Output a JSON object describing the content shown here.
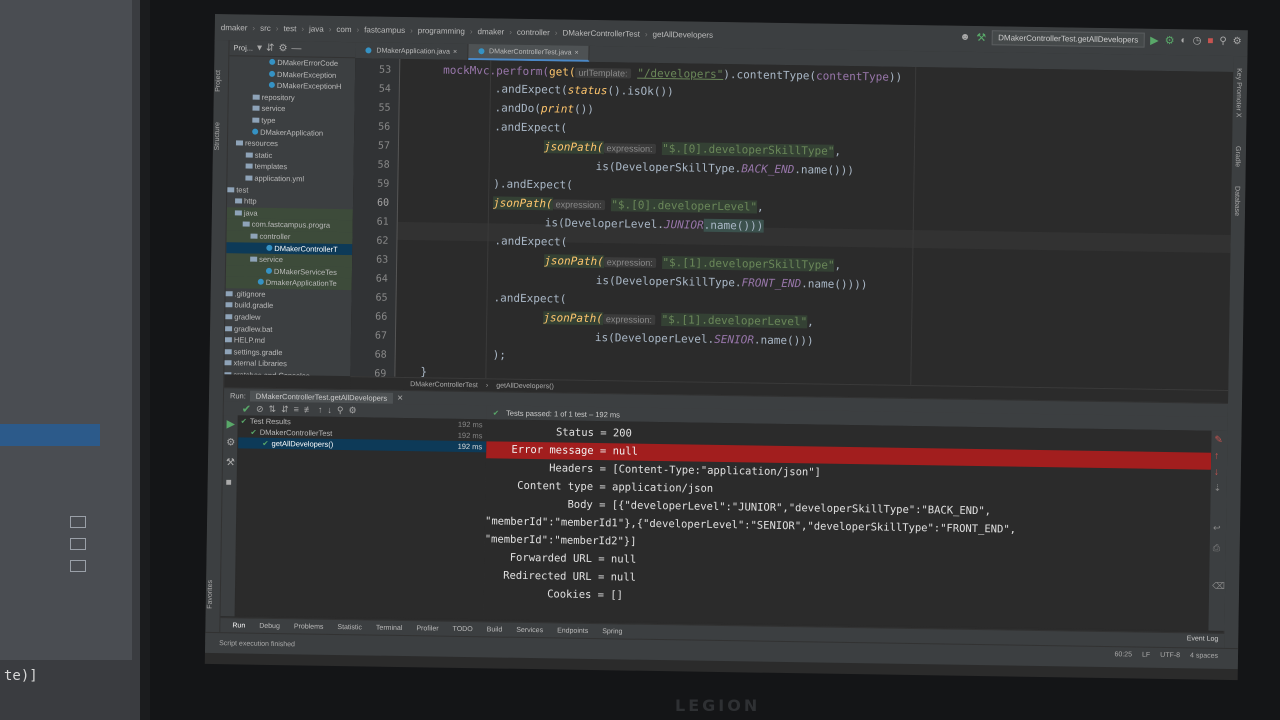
{
  "left_monitor": {
    "fragment_text": "te)]"
  },
  "monitor_brand": "LEGION",
  "nav": {
    "crumbs": [
      "dmaker",
      "src",
      "test",
      "java",
      "com",
      "fastcampus",
      "programming",
      "dmaker",
      "controller",
      "DMakerControllerTest",
      "getAllDevelopers"
    ],
    "run_config": "DMakerControllerTest.getAllDevelopers"
  },
  "project": {
    "header": "Proj...",
    "items": [
      {
        "label": "DMakerErrorCode",
        "indent": 40,
        "kind": "class"
      },
      {
        "label": "DMakerException",
        "indent": 40,
        "kind": "class"
      },
      {
        "label": "DMakerExceptionH",
        "indent": 40,
        "kind": "class"
      },
      {
        "label": "repository",
        "indent": 24,
        "kind": "folder"
      },
      {
        "label": "service",
        "indent": 24,
        "kind": "folder"
      },
      {
        "label": "type",
        "indent": 24,
        "kind": "folder"
      },
      {
        "label": "DMakerApplication",
        "indent": 24,
        "kind": "class"
      },
      {
        "label": "resources",
        "indent": 8,
        "kind": "folder"
      },
      {
        "label": "static",
        "indent": 18,
        "kind": "folder"
      },
      {
        "label": "templates",
        "indent": 18,
        "kind": "folder"
      },
      {
        "label": "application.yml",
        "indent": 18,
        "kind": "file"
      },
      {
        "label": "test",
        "indent": 0,
        "kind": "folder"
      },
      {
        "label": "http",
        "indent": 8,
        "kind": "folder"
      },
      {
        "label": "java",
        "indent": 8,
        "kind": "folder",
        "hl": true
      },
      {
        "label": "com.fastcampus.progra",
        "indent": 16,
        "kind": "folder",
        "hl": true
      },
      {
        "label": "controller",
        "indent": 24,
        "kind": "folder",
        "hl": true
      },
      {
        "label": "DMakerControllerT",
        "indent": 40,
        "kind": "class",
        "sel": true
      },
      {
        "label": "service",
        "indent": 24,
        "kind": "folder",
        "hl": true
      },
      {
        "label": "DMakerServiceTes",
        "indent": 40,
        "kind": "class",
        "hl": true
      },
      {
        "label": "DmakerApplicationTe",
        "indent": 32,
        "kind": "class",
        "hl": true
      },
      {
        "label": ".gitignore",
        "indent": 0,
        "kind": "file"
      },
      {
        "label": "build.gradle",
        "indent": 0,
        "kind": "file"
      },
      {
        "label": "gradlew",
        "indent": 0,
        "kind": "file"
      },
      {
        "label": "gradlew.bat",
        "indent": 0,
        "kind": "file"
      },
      {
        "label": "HELP.md",
        "indent": 0,
        "kind": "file"
      },
      {
        "label": "settings.gradle",
        "indent": 0,
        "kind": "file"
      },
      {
        "label": "xternal Libraries",
        "indent": 0,
        "kind": "lib"
      },
      {
        "label": "cratches and Consoles",
        "indent": 0,
        "kind": "lib"
      }
    ]
  },
  "side_labels": {
    "left": [
      "Project",
      "Structure",
      "Favorites"
    ],
    "right": [
      "Key Promoter X",
      "Gradle",
      "Database"
    ]
  },
  "editor": {
    "tabs": [
      {
        "label": "DMakerApplication.java",
        "active": false
      },
      {
        "label": "DMakerControllerTest.java",
        "active": true
      }
    ],
    "line_numbers": [
      "53",
      "54",
      "55",
      "56",
      "57",
      "58",
      "59",
      "60",
      "61",
      "62",
      "63",
      "64",
      "65",
      "66",
      "67",
      "68",
      "69"
    ],
    "current_line": "60",
    "lines": {
      "l53": {
        "a": "mockMvc.perform(",
        "b": "get(",
        "hint": "urlTemplate:",
        "str": "\"/developers\"",
        "c": ").contentType(",
        "d": "contentType",
        "e": "))"
      },
      "l54": {
        "a": ".andExpect(",
        "b": "status",
        "c": "().isOk())"
      },
      "l55": {
        "a": ".andDo(",
        "b": "print",
        "c": "())"
      },
      "l56": {
        "a": ".andExpect("
      },
      "l57": {
        "a": "jsonPath(",
        "hint": "expression:",
        "str": "\"$.[0].developerSkillType\"",
        "c": ","
      },
      "l58": {
        "a": "is(DeveloperSkillType.",
        "b": "BACK_END",
        "c": ".name()))"
      },
      "l59": {
        "a": ").andExpect("
      },
      "l60": {
        "a": "jsonPath(",
        "hint": "expression:",
        "str": "\"$.[0].developerLevel\"",
        "c": ","
      },
      "l61": {
        "a": "is(DeveloperLevel.",
        "b": "JUNIOR",
        "c": ".name()))"
      },
      "l62": {
        "a": ".andExpect("
      },
      "l63": {
        "a": "jsonPath(",
        "hint": "expression:",
        "str": "\"$.[1].developerSkillType\"",
        "c": ","
      },
      "l64": {
        "a": "is(DeveloperSkillType.",
        "b": "FRONT_END",
        "c": ".name())))"
      },
      "l65": {
        "a": ".andExpect("
      },
      "l66": {
        "a": "jsonPath(",
        "hint": "expression:",
        "str": "\"$.[1].developerLevel\"",
        "c": ","
      },
      "l67": {
        "a": "is(DeveloperLevel.",
        "b": "SENIOR",
        "c": ".name()))"
      },
      "l68": {
        "a": ");"
      },
      "l69": {
        "a": "}"
      }
    },
    "breadcrumbs": [
      "DMakerControllerTest",
      "getAllDevelopers()"
    ]
  },
  "run": {
    "label": "Run:",
    "tab": "DMakerControllerTest.getAllDevelopers",
    "status": "Tests passed: 1 of 1 test – 192 ms",
    "tree": [
      {
        "label": "Test Results",
        "time": "192 ms",
        "indent": 2,
        "sel": false
      },
      {
        "label": "DMakerControllerTest",
        "time": "192 ms",
        "indent": 12,
        "sel": false
      },
      {
        "label": "getAllDevelopers()",
        "time": "192 ms",
        "indent": 24,
        "sel": true
      }
    ],
    "console": [
      {
        "text": "           Status = 200",
        "error": false
      },
      {
        "text": "    Error message = null",
        "error": true
      },
      {
        "text": "          Headers = [Content-Type:\"application/json\"]",
        "error": false
      },
      {
        "text": "     Content type = application/json",
        "error": false
      },
      {
        "text": "             Body = [{\"developerLevel\":\"JUNIOR\",\"developerSkillType\":\"BACK_END\",",
        "error": false
      },
      {
        "text": "\"memberId\":\"memberId1\"},{\"developerLevel\":\"SENIOR\",\"developerSkillType\":\"FRONT_END\",",
        "error": false
      },
      {
        "text": "\"memberId\":\"memberId2\"}]",
        "error": false
      },
      {
        "text": "    Forwarded URL = null",
        "error": false
      },
      {
        "text": "   Redirected URL = null",
        "error": false
      },
      {
        "text": "          Cookies = []",
        "error": false
      }
    ]
  },
  "bottom_tabs": [
    "Run",
    "Debug",
    "Problems",
    "Statistic",
    "Terminal",
    "Profiler",
    "TODO",
    "Build",
    "Services",
    "Endpoints",
    "Spring"
  ],
  "status_bar": {
    "message": "Script execution finished",
    "position": "60:25",
    "line_sep": "LF",
    "encoding": "UTF-8",
    "indent": "4 spaces",
    "event_log": "Event Log"
  },
  "colors": {
    "error_highlight": "#a21e1e",
    "selection": "#0d3a58",
    "pass_green": "#59a869"
  }
}
